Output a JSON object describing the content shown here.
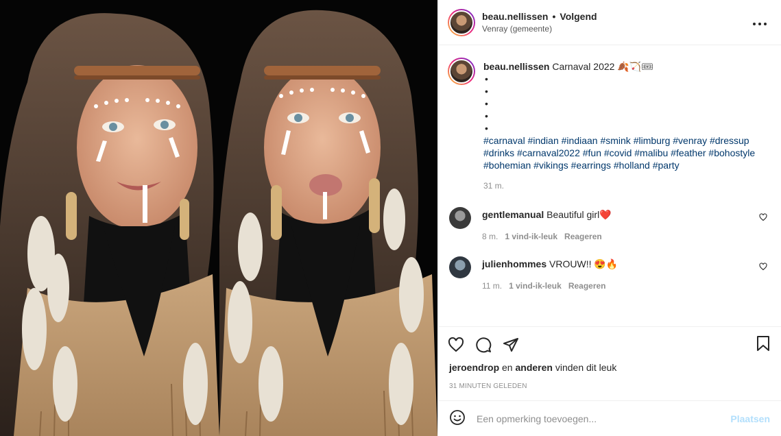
{
  "header": {
    "username": "beau.nellissen",
    "separator": "•",
    "follow_label": "Volgend",
    "location": "Venray (gemeente)",
    "more_label": "•••"
  },
  "caption": {
    "username": "beau.nellissen",
    "text": "Carnaval 2022 🍂🏹🎟",
    "bullets": [
      "",
      "",
      "",
      "",
      ""
    ],
    "hashtags": "#carnaval #indian #indiaan #smink #limburg #venray #dressup #drinks #carnaval2022 #fun #covid #malibu #feather #bohostyle #bohemian #vikings #earrings #holland #party",
    "time": "31 m."
  },
  "comments": [
    {
      "username": "gentlemanual",
      "text": "Beautiful girl❤️",
      "time": "8 m.",
      "likes": "1 vind-ik-leuk",
      "reply": "Reageren"
    },
    {
      "username": "julienhommes",
      "text": "VROUW!! 😍🔥",
      "time": "11 m.",
      "likes": "1 vind-ik-leuk",
      "reply": "Reageren"
    }
  ],
  "likes": {
    "user": "jeroendrop",
    "connector": "en",
    "others": "anderen",
    "suffix": "vinden dit leuk"
  },
  "posted": "31 MINUTEN GELEDEN",
  "add_comment": {
    "placeholder": "Een opmerking toevoegen...",
    "post_label": "Plaatsen"
  },
  "icons": {
    "more": "more-dots-icon",
    "like": "heart-icon",
    "comment": "comment-bubble-icon",
    "share": "paper-plane-icon",
    "save": "bookmark-icon",
    "emoji": "smiley-icon"
  },
  "colors": {
    "link": "#00376b",
    "muted": "#8e8e8e",
    "post_disabled": "#b2dffc"
  }
}
